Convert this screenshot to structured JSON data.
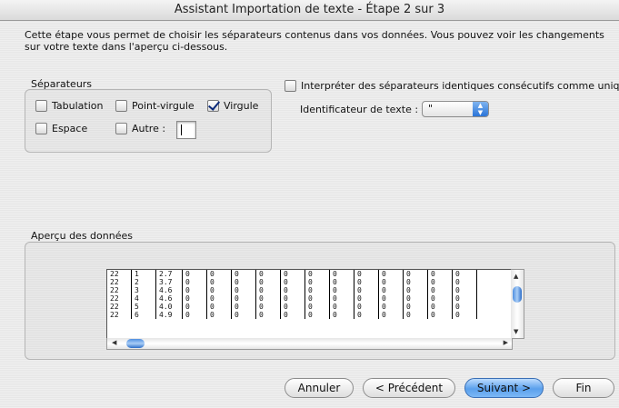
{
  "window": {
    "title": "Assistant Importation de texte - Étape 2 sur 3"
  },
  "description": "Cette étape vous permet de choisir les séparateurs contenus dans vos données. Vous pouvez voir les changements sur votre texte dans l'aperçu ci-dessous.",
  "separators": {
    "group_label": "Séparateurs",
    "tab_label": "Tabulation",
    "semicolon_label": "Point-virgule",
    "comma_label": "Virgule",
    "space_label": "Espace",
    "other_label": "Autre :",
    "tab_checked": false,
    "semicolon_checked": false,
    "comma_checked": true,
    "space_checked": false,
    "other_checked": false,
    "other_value": ""
  },
  "consecutive": {
    "label": "Interpréter des séparateurs identiques consécutifs comme uniques",
    "checked": false
  },
  "text_qualifier": {
    "label": "Identificateur de texte :",
    "value": "\""
  },
  "preview": {
    "group_label": "Aperçu des données",
    "rows": [
      [
        "22",
        "1",
        "2.7",
        "0",
        "0",
        "0",
        "0",
        "0",
        "0",
        "0",
        "0",
        "0",
        "0",
        "0",
        "0"
      ],
      [
        "22",
        "2",
        "3.7",
        "0",
        "0",
        "0",
        "0",
        "0",
        "0",
        "0",
        "0",
        "0",
        "0",
        "0",
        "0"
      ],
      [
        "22",
        "3",
        "4.6",
        "0",
        "0",
        "0",
        "0",
        "0",
        "0",
        "0",
        "0",
        "0",
        "0",
        "0",
        "0"
      ],
      [
        "22",
        "4",
        "4.6",
        "0",
        "0",
        "0",
        "0",
        "0",
        "0",
        "0",
        "0",
        "0",
        "0",
        "0",
        "0"
      ],
      [
        "22",
        "5",
        "4.0",
        "0",
        "0",
        "0",
        "0",
        "0",
        "0",
        "0",
        "0",
        "0",
        "0",
        "0",
        "0"
      ],
      [
        "22",
        "6",
        "4.9",
        "0",
        "0",
        "0",
        "0",
        "0",
        "0",
        "0",
        "0",
        "0",
        "0",
        "0",
        "0"
      ]
    ]
  },
  "buttons": {
    "cancel": "Annuler",
    "back": "< Précédent",
    "next": "Suivant >",
    "finish": "Fin"
  },
  "colors": {
    "primary_button": "#5aa0ec",
    "window_bg": "#ececec"
  }
}
